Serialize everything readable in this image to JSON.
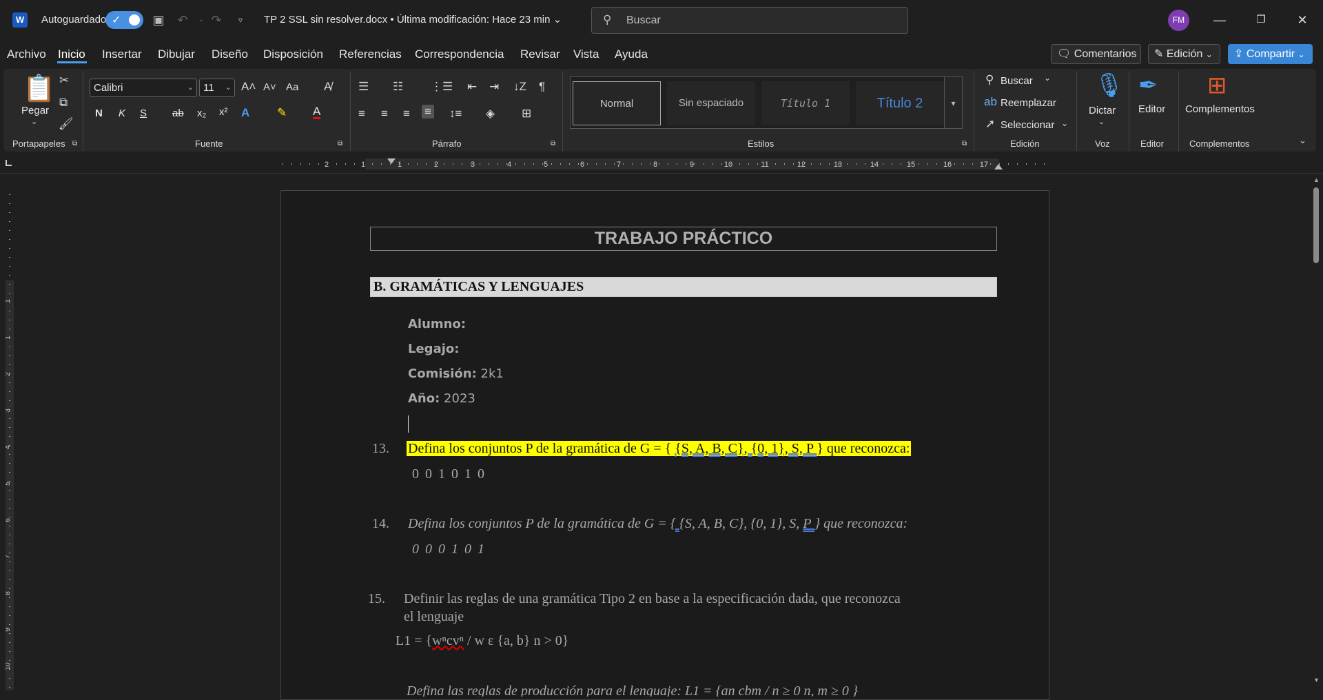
{
  "titlebar": {
    "autosave_label": "Autoguardado",
    "doc_title": "TP 2 SSL sin resolver.docx • Última modificación: Hace 23 min",
    "search_placeholder": "Buscar",
    "avatar_initials": "FM"
  },
  "menu": {
    "items": [
      "Archivo",
      "Inicio",
      "Insertar",
      "Dibujar",
      "Diseño",
      "Disposición",
      "Referencias",
      "Correspondencia",
      "Revisar",
      "Vista",
      "Ayuda"
    ],
    "active": "Inicio",
    "comments_label": "Comentarios",
    "editing_label": "Edición",
    "share_label": "Compartir"
  },
  "ribbon": {
    "clipboard": {
      "paste_label": "Pegar",
      "group_label": "Portapapeles"
    },
    "font": {
      "family": "Calibri",
      "size": "11",
      "group_label": "Fuente",
      "bold": "N",
      "italic": "K",
      "underline": "S",
      "strike": "ab",
      "subscript": "x₂",
      "superscript": "x²",
      "case": "Aa"
    },
    "paragraph": {
      "group_label": "Párrafo"
    },
    "styles": {
      "items": [
        "Normal",
        "Sin espaciado",
        "Título 1",
        "Título 2"
      ],
      "group_label": "Estilos"
    },
    "editing": {
      "find": "Buscar",
      "replace": "Reemplazar",
      "select": "Seleccionar",
      "group_label": "Edición"
    },
    "voice": {
      "dictate": "Dictar",
      "group_label": "Voz"
    },
    "editor": {
      "label": "Editor",
      "group_label": "Editor"
    },
    "addins": {
      "label": "Complementos",
      "group_label": "Complementos"
    }
  },
  "ruler": {
    "h_ticks": [
      "2",
      "1",
      "1",
      "2",
      "3",
      "4",
      "5",
      "6",
      "7",
      "8",
      "9",
      "10",
      "11",
      "12",
      "13",
      "14",
      "15",
      "16",
      "17"
    ],
    "v_ticks": [
      "1",
      "1",
      "2",
      "3",
      "4",
      "5",
      "6",
      "7",
      "8",
      "9",
      "10",
      "11"
    ]
  },
  "document": {
    "title": "TRABAJO PRÁCTICO",
    "section": "B. GRAMÁTICAS Y LENGUAJES",
    "fields": [
      {
        "label": "Alumno:",
        "value": ""
      },
      {
        "label": "Legajo:",
        "value": ""
      },
      {
        "label": "Comisión:",
        "value": "2k1"
      },
      {
        "label": "Año:",
        "value": "2023"
      }
    ],
    "q13": {
      "num": "13.",
      "text_a": "Defina los conjuntos P de la gramática de G = { ",
      "text_b": "{S, A, B, C}, {0, 1}, S, ",
      "text_c": "P ",
      "text_d": "} que reconozca:",
      "seq": "0 0 1 0 1 0"
    },
    "q14": {
      "num": "14.",
      "text_a": "Defina los conjuntos P de la gramática de G = ",
      "text_b": "{ ",
      "text_c": "{S, A, B, C}, {0, 1}, S, ",
      "text_d": "P ",
      "text_e": "} que reconozca:",
      "seq": "0 0 0 1 0 1"
    },
    "q15": {
      "num": "15.",
      "line1": "Definir las reglas de una gramática Tipo 2 en base a la especificación dada, que reconozca",
      "line2": "el lenguaje",
      "lang_a": "L1 = {",
      "lang_b": "wⁿcvⁿ",
      "lang_c": " / w ε {a, b} n > 0}"
    },
    "q16_partial": "Defina las reglas de producción para el lenguaje: L1 = {an cbm / n ≥ 0 n, m ≥ 0 }"
  },
  "colors": {
    "accent": "#4a9ef0",
    "highlight": "#ffff00",
    "share": "#3a86d6"
  }
}
